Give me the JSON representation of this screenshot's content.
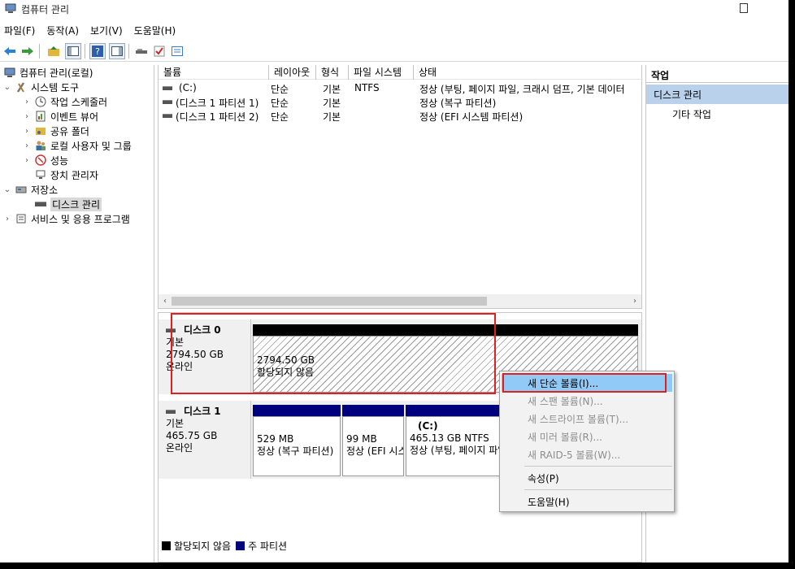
{
  "window": {
    "title": "컴퓨터 관리"
  },
  "menu": [
    "파일(F)",
    "동작(A)",
    "보기(V)",
    "도움말(H)"
  ],
  "tree": {
    "root": "컴퓨터 관리(로컬)",
    "system_tools": "시스템 도구",
    "task_scheduler": "작업 스케줄러",
    "event_viewer": "이벤트 뷰어",
    "shared_folders": "공유 폴더",
    "local_users": "로컬 사용자 및 그룹",
    "performance": "성능",
    "device_manager": "장치 관리자",
    "storage": "저장소",
    "disk_management": "디스크 관리",
    "services": "서비스 및 응용 프로그램"
  },
  "volume_list": {
    "columns": [
      "볼륨",
      "레이아웃",
      "형식",
      "파일 시스템",
      "상태"
    ],
    "rows": [
      {
        "volume": "(C:)",
        "layout": "단순",
        "type": "기본",
        "fs": "NTFS",
        "status": "정상 (부팅, 페이지 파일, 크래시 덤프, 기본 데이터"
      },
      {
        "volume": "(디스크 1 파티션 1)",
        "layout": "단순",
        "type": "기본",
        "fs": "",
        "status": "정상 (복구 파티션)"
      },
      {
        "volume": "(디스크 1 파티션 2)",
        "layout": "단순",
        "type": "기본",
        "fs": "",
        "status": "정상 (EFI 시스템 파티션)"
      }
    ]
  },
  "disks": [
    {
      "name": "디스크 0",
      "type": "기본",
      "size": "2794.50 GB",
      "status": "온라인",
      "partitions": [
        {
          "size": "2794.50 GB",
          "status": "할당되지 않음",
          "bar_color": "#000000"
        }
      ]
    },
    {
      "name": "디스크 1",
      "type": "기본",
      "size": "465.75 GB",
      "status": "온라인",
      "partitions": [
        {
          "name": "",
          "size": "529 MB",
          "status": "정상 (복구 파티션)",
          "bar_color": "#00007f"
        },
        {
          "name": "",
          "size": "99 MB",
          "status": "정상 (EFI 시스템)",
          "bar_color": "#00007f"
        },
        {
          "name": "(C:)",
          "size": "465.13 GB NTFS",
          "status": "정상 (부팅, 페이지 파일)",
          "bar_color": "#00007f"
        }
      ]
    }
  ],
  "legend": {
    "unallocated": "할당되지 않음",
    "primary": "주 파티션",
    "unallocated_color": "#000000",
    "primary_color": "#00007f"
  },
  "actions": {
    "title": "작업",
    "section": "디스크 관리",
    "more": "기타 작업"
  },
  "context_menu": {
    "new_simple": "새 단순 볼륨(I)...",
    "new_spanned": "새 스팬 볼륨(N)...",
    "new_striped": "새 스트라이프 볼륨(T)...",
    "new_mirrored": "새 미러 볼륨(R)...",
    "new_raid5": "새 RAID-5 볼륨(W)...",
    "properties": "속성(P)",
    "help": "도움말(H)"
  },
  "colors": {
    "highlight": "#91c9f7",
    "annotation": "#e02020",
    "actions_header": "#b9d1ea"
  }
}
